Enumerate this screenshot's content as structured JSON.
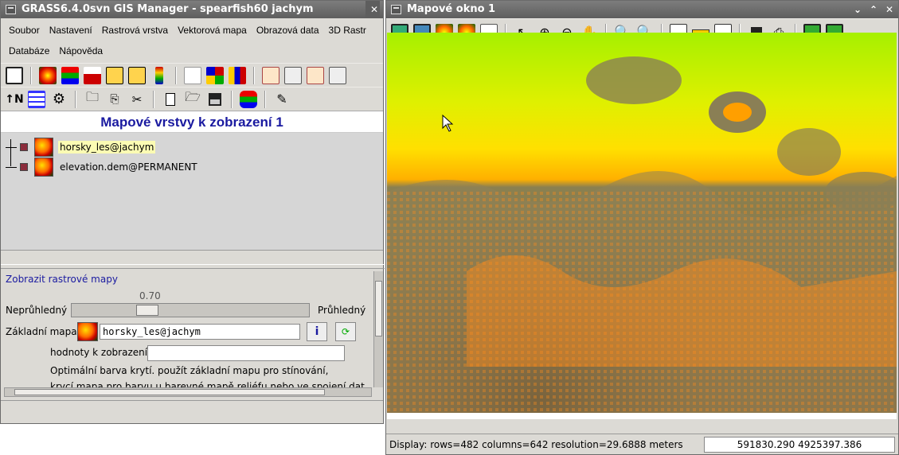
{
  "gm_window": {
    "title": "GRASS6.4.0svn GIS Manager - spearfish60 jachym",
    "menu": [
      "Soubor",
      "Nastavení",
      "Rastrová vrstva",
      "Vektorová mapa",
      "Obrazová data",
      "3D Rastr",
      "Databáze",
      "Nápověda"
    ],
    "layers_header": "Mapové vrstvy k zobrazení 1",
    "layers": [
      {
        "name": "horsky_les@jachym",
        "selected": true
      },
      {
        "name": "elevation.dem@PERMANENT",
        "selected": false
      }
    ],
    "props": {
      "title": "Zobrazit rastrové mapy",
      "opacity_value": "0.70",
      "opacity": 0.7,
      "left_label": "Neprůhledný",
      "right_label": "Průhledný",
      "base_label": "Základní mapa:",
      "base_value": "horsky_les@jachym",
      "values_label": "hodnoty k zobrazení",
      "desc_line1": "Optimální barva krytí. použít základní mapu pro stínování,",
      "desc_line2": "krycí mapa pro barvu u barevné mapě reliéfu nebo ve spojení dat"
    }
  },
  "map_window": {
    "title": "Mapové okno 1",
    "status_left": "Display: rows=482 columns=642  resolution=29.6888 meters",
    "coords": "591830.290 4925397.386"
  },
  "colors": {
    "title_bg": "#5e5e5e",
    "header_text": "#1a1aa0",
    "panel": "#dcdad5"
  }
}
